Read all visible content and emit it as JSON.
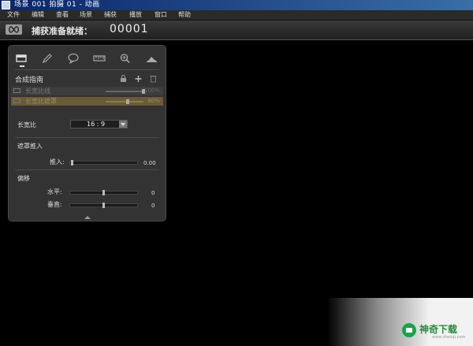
{
  "window": {
    "title": "场景 001  拍摄 01 - 动画"
  },
  "menu": [
    "文件",
    "编辑",
    "查看",
    "场景",
    "捕获",
    "播放",
    "窗口",
    "帮助"
  ],
  "capture": {
    "status": "捕获准备就绪：",
    "count": "00001"
  },
  "tools": [
    {
      "name": "frame-tool-icon",
      "active": true
    },
    {
      "name": "pencil-tool-icon"
    },
    {
      "name": "comment-tool-icon"
    },
    {
      "name": "ruler-tool-icon"
    },
    {
      "name": "zoom-tool-icon"
    },
    {
      "name": "levels-tool-icon"
    }
  ],
  "composite": {
    "title": "合成指南",
    "tracks": [
      {
        "label": "长宽比线",
        "percent": "100%",
        "level": 1.0
      },
      {
        "label": "长宽比遮罩",
        "percent": "80%",
        "level": 0.8
      }
    ]
  },
  "aspect": {
    "label": "长宽比",
    "value": "16 : 9"
  },
  "filter": {
    "title": "遮罩推入",
    "push_label": "推入:",
    "push_value": "0.00"
  },
  "offset": {
    "title": "偏移",
    "h_label": "水平:",
    "h_value": "0",
    "v_label": "垂直:",
    "v_value": "0"
  },
  "watermark": {
    "text": "神奇下载",
    "url": "www.shenqi.com"
  },
  "colors": {
    "highlight_track": "#6b5a38",
    "title_gradient_start": "#0a246a"
  }
}
